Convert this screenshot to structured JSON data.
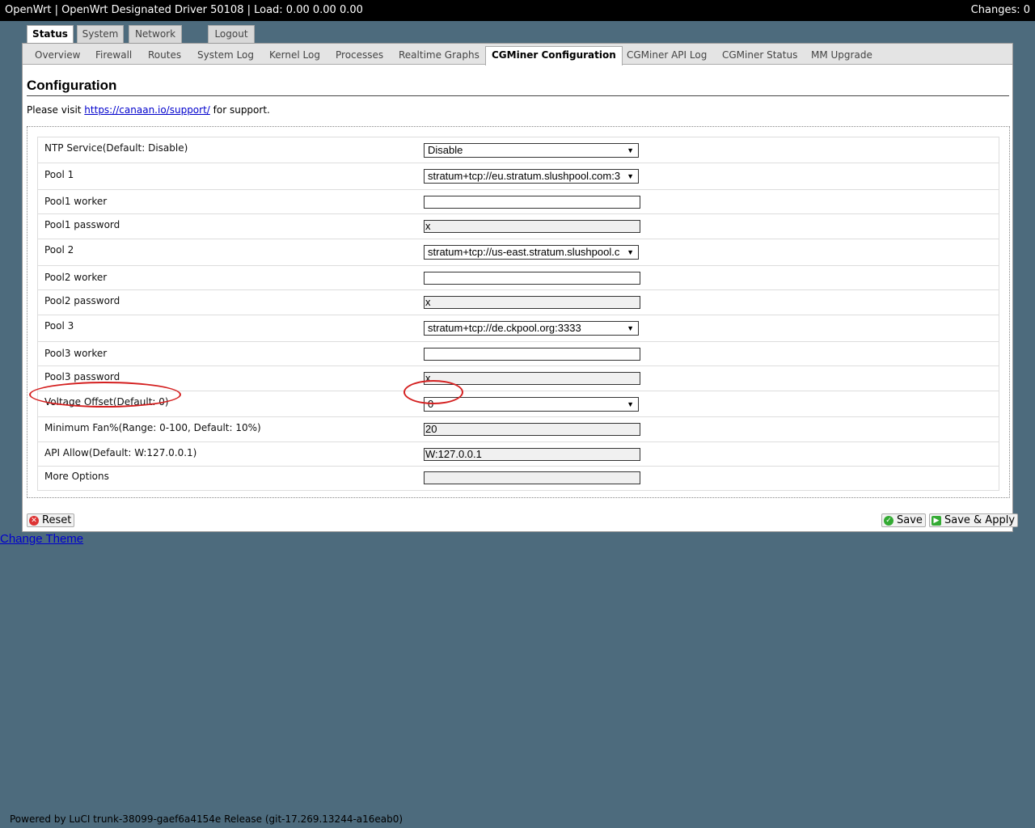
{
  "topbar": {
    "title": "OpenWrt | OpenWrt Designated Driver 50108 | Load: 0.00 0.00 0.00",
    "changes": "Changes: 0"
  },
  "main_tabs": [
    "Status",
    "System",
    "Network",
    "Logout"
  ],
  "active_main_tab": "Status",
  "sub_tabs": [
    "Overview",
    "Firewall",
    "Routes",
    "System Log",
    "Kernel Log",
    "Processes",
    "Realtime Graphs",
    "CGMiner Configuration",
    "CGMiner API Log",
    "CGMiner Status",
    "MM Upgrade"
  ],
  "active_sub_tab": "CGMiner Configuration",
  "heading": "Configuration",
  "support": {
    "prefix": "Please visit ",
    "link": "https://canaan.io/support/",
    "suffix": " for support."
  },
  "rows": [
    {
      "label": "NTP Service(Default: Disable)",
      "type": "select",
      "value": "Disable"
    },
    {
      "label": "Pool 1",
      "type": "select",
      "value": "stratum+tcp://eu.stratum.slushpool.com:3"
    },
    {
      "label": "Pool1 worker",
      "type": "input",
      "value": ""
    },
    {
      "label": "Pool1 password",
      "type": "input",
      "value": "x"
    },
    {
      "label": "Pool 2",
      "type": "select",
      "value": "stratum+tcp://us-east.stratum.slushpool.c"
    },
    {
      "label": "Pool2 worker",
      "type": "input",
      "value": ""
    },
    {
      "label": "Pool2 password",
      "type": "input",
      "value": "x"
    },
    {
      "label": "Pool 3",
      "type": "select",
      "value": "stratum+tcp://de.ckpool.org:3333"
    },
    {
      "label": "Pool3 worker",
      "type": "input",
      "value": ""
    },
    {
      "label": "Pool3 password",
      "type": "input",
      "value": "x"
    },
    {
      "label": "Voltage Offset(Default: 0)",
      "type": "select",
      "value": "0"
    },
    {
      "label": "Minimum Fan%(Range: 0-100, Default: 10%)",
      "type": "input",
      "value": "20"
    },
    {
      "label": "API Allow(Default: W:127.0.0.1)",
      "type": "input",
      "value": "W:127.0.0.1"
    },
    {
      "label": "More Options",
      "type": "input",
      "value": ""
    }
  ],
  "buttons": {
    "reset": "Reset",
    "save": "Save",
    "save_apply": "Save & Apply"
  },
  "change_theme": "Change Theme",
  "footer": "Powered by LuCI trunk-38099-gaef6a4154e Release (git-17.269.13244-a16eab0)",
  "colors": {
    "page_bg": "#4d6b7d",
    "annotation": "#d42020",
    "link": "#0000cc"
  }
}
